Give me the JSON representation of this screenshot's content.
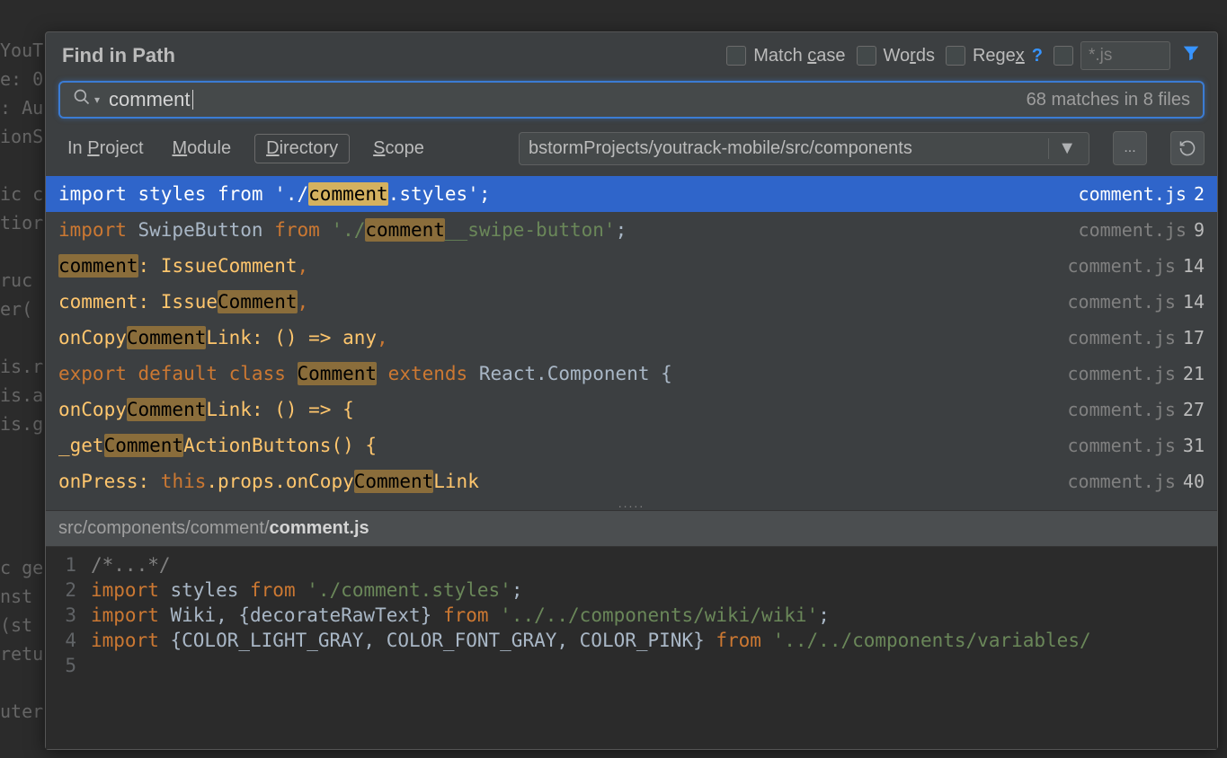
{
  "bg_snippets": [
    "YouT",
    "e: 0",
    ": Au",
    "ionS",
    "",
    "ic c",
    "tior",
    "",
    "ruc",
    "er(",
    "",
    "is.r",
    "is.a",
    "is.g",
    "",
    "",
    "",
    "",
    "c ge",
    "nst ",
    " (st",
    "retu",
    "",
    "uter"
  ],
  "dialog": {
    "title": "Find in Path",
    "match_case": "Match case",
    "words": "Words",
    "regex": "Regex",
    "regex_help": "?",
    "file_mask_placeholder": "*.js"
  },
  "search": {
    "value": "comment",
    "count": "68 matches in 8 files"
  },
  "scopes": {
    "in_project": "In Project",
    "module": "Module",
    "directory": "Directory",
    "scope": "Scope",
    "path": "bstormProjects/youtrack-mobile/src/components",
    "ellipsis": "...",
    "refresh": "↻"
  },
  "results": [
    {
      "segments": [
        {
          "t": "import styles from './",
          "c": "white"
        },
        {
          "t": "comment",
          "c": "hl-sel"
        },
        {
          "t": ".styles';",
          "c": "white"
        }
      ],
      "file": "comment.js",
      "line": "2",
      "selected": true
    },
    {
      "segments": [
        {
          "t": "import",
          "c": "kw"
        },
        {
          "t": " SwipeButton ",
          "c": "whitish"
        },
        {
          "t": "from ",
          "c": "kw"
        },
        {
          "t": "'./",
          "c": "str"
        },
        {
          "t": "comment",
          "c": "hl"
        },
        {
          "t": "__swipe-button'",
          "c": "str"
        },
        {
          "t": ";",
          "c": "whitish"
        }
      ],
      "file": "comment.js",
      "line": "9"
    },
    {
      "segments": [
        {
          "t": "comment",
          "c": "hl"
        },
        {
          "t": ": IssueComment",
          "c": "prop"
        },
        {
          "t": ",",
          "c": "kw"
        }
      ],
      "file": "comment.js",
      "line": "14"
    },
    {
      "segments": [
        {
          "t": "comment: Issue",
          "c": "prop"
        },
        {
          "t": "Comment",
          "c": "hl"
        },
        {
          "t": ",",
          "c": "kw"
        }
      ],
      "file": "comment.js",
      "line": "14"
    },
    {
      "segments": [
        {
          "t": "onCopy",
          "c": "prop"
        },
        {
          "t": "Comment",
          "c": "hl"
        },
        {
          "t": "Link: () => any",
          "c": "prop"
        },
        {
          "t": ",",
          "c": "kw"
        }
      ],
      "file": "comment.js",
      "line": "17"
    },
    {
      "segments": [
        {
          "t": "export default class ",
          "c": "kw"
        },
        {
          "t": "Comment",
          "c": "hl"
        },
        {
          "t": " extends",
          "c": "kw"
        },
        {
          "t": " React.Component {",
          "c": "whitish"
        }
      ],
      "file": "comment.js",
      "line": "21"
    },
    {
      "segments": [
        {
          "t": "onCopy",
          "c": "prop"
        },
        {
          "t": "Comment",
          "c": "hl"
        },
        {
          "t": "Link: () => {",
          "c": "prop"
        }
      ],
      "file": "comment.js",
      "line": "27"
    },
    {
      "segments": [
        {
          "t": "_get",
          "c": "prop"
        },
        {
          "t": "Comment",
          "c": "hl"
        },
        {
          "t": "ActionButtons() {",
          "c": "prop"
        }
      ],
      "file": "comment.js",
      "line": "31"
    },
    {
      "segments": [
        {
          "t": "onPress: ",
          "c": "prop"
        },
        {
          "t": "this",
          "c": "this-kw"
        },
        {
          "t": ".props.onCopy",
          "c": "prop"
        },
        {
          "t": "Comment",
          "c": "hl"
        },
        {
          "t": "Link",
          "c": "prop"
        }
      ],
      "file": "comment.js",
      "line": "40"
    }
  ],
  "file_path": {
    "prefix": "src/components/comment/",
    "name": "comment.js"
  },
  "preview": [
    {
      "n": "1",
      "segs": [
        {
          "t": "/*...*/",
          "c": "comment-c"
        }
      ]
    },
    {
      "n": "2",
      "segs": [
        {
          "t": "import",
          "c": "kw"
        },
        {
          "t": " styles ",
          "c": "whitish"
        },
        {
          "t": "from",
          "c": "kw"
        },
        {
          "t": " ",
          "c": ""
        },
        {
          "t": "'./comment.styles'",
          "c": "str"
        },
        {
          "t": ";",
          "c": "whitish"
        }
      ]
    },
    {
      "n": "3",
      "segs": [
        {
          "t": "import",
          "c": "kw"
        },
        {
          "t": " Wiki, {decorateRawText} ",
          "c": "whitish"
        },
        {
          "t": "from",
          "c": "kw"
        },
        {
          "t": " ",
          "c": ""
        },
        {
          "t": "'../../components/wiki/wiki'",
          "c": "str"
        },
        {
          "t": ";",
          "c": "whitish"
        }
      ]
    },
    {
      "n": "4",
      "segs": [
        {
          "t": "import",
          "c": "kw"
        },
        {
          "t": " {COLOR_LIGHT_GRAY, COLOR_FONT_GRAY, COLOR_PINK} ",
          "c": "whitish"
        },
        {
          "t": "from",
          "c": "kw"
        },
        {
          "t": " ",
          "c": ""
        },
        {
          "t": "'../../components/variables/",
          "c": "str"
        }
      ]
    },
    {
      "n": "5",
      "segs": []
    }
  ]
}
